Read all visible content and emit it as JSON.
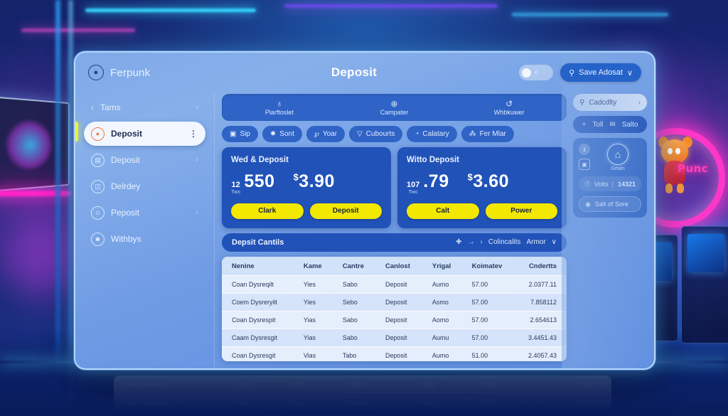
{
  "app": {
    "brand": "Ferpunk",
    "brand_icon": "user-circle-icon",
    "title": "Deposit"
  },
  "topbar": {
    "toggle_icon": "toggle-knob-icon",
    "toggle_chevron": "‹",
    "save_button": {
      "icon": "search-icon",
      "label": "Save Adosat",
      "chevron": "∨"
    }
  },
  "sidebar": {
    "back_chevron": "‹",
    "items": [
      {
        "label": "Tams",
        "icon": "chevron-left-icon",
        "trailing": "›",
        "active": false,
        "kind": "back"
      },
      {
        "label": "Deposit",
        "icon": "coin-icon",
        "trailing": "⋮",
        "active": true,
        "kind": "item"
      },
      {
        "label": "Deposit",
        "icon": "wallet-icon",
        "trailing": "›",
        "active": false,
        "kind": "item"
      },
      {
        "label": "Delrdey",
        "icon": "card-icon",
        "trailing": "",
        "active": false,
        "kind": "item"
      },
      {
        "label": "Peposit",
        "icon": "face-icon",
        "trailing": "›",
        "active": false,
        "kind": "item"
      },
      {
        "label": "Withbys",
        "icon": "smiley-icon",
        "trailing": "",
        "active": false,
        "kind": "item"
      }
    ]
  },
  "tabs": [
    {
      "label": "Plarftoslet",
      "icon": "person-icon",
      "glyph": "♁"
    },
    {
      "label": "Campater",
      "icon": "clock-icon",
      "glyph": "⊕"
    },
    {
      "label": "Whbkuwer",
      "icon": "refresh-icon",
      "glyph": "↺"
    }
  ],
  "chips": [
    {
      "label": "Sip",
      "icon": "briefcase-icon",
      "glyph": "▣"
    },
    {
      "label": "Sont",
      "icon": "star-icon",
      "glyph": "✸"
    },
    {
      "label": "Yoar",
      "icon": "link-icon",
      "glyph": "℘"
    },
    {
      "label": "Cubourts",
      "icon": "filter-icon",
      "glyph": "▽"
    },
    {
      "label": "Calatary",
      "icon": "clock-icon",
      "glyph": "◔"
    },
    {
      "label": "Fer Mlar",
      "icon": "share-icon",
      "glyph": "⁂"
    }
  ],
  "stat_cards": [
    {
      "title": "Wed & Deposit",
      "badge_top": "12",
      "badge_bottom": "Twc",
      "primary_value": "550",
      "currency_symbol": "$",
      "secondary_value": "3.90",
      "buttons": [
        "Clark",
        "Deposit"
      ]
    },
    {
      "title": "Witto Deposit",
      "badge_top": "107",
      "badge_bottom": "Twc",
      "primary_value": ".79",
      "currency_symbol": "$",
      "secondary_value": "3.60",
      "buttons": [
        "Calt",
        "Power"
      ]
    }
  ],
  "right_panel": {
    "search": {
      "icon": "search-icon",
      "label": "Cadcdlty",
      "chevron": "›"
    },
    "actions": {
      "add_icon": "plus-icon",
      "add_label": "Toll",
      "mail_icon": "mail-icon",
      "mail_label": "Salto"
    },
    "side_icons": [
      "info-icon",
      "copy-icon"
    ],
    "home": {
      "icon": "home-icon",
      "label": "Grtatn"
    },
    "stat": {
      "icon": "volt-icon",
      "label": "Volts",
      "separator": "|",
      "value": "14321"
    },
    "button": {
      "icon": "target-icon",
      "label": "Salt of Sore"
    }
  },
  "table": {
    "title": "Depsit Cantils",
    "head_actions": {
      "pin_icon": "✚",
      "arrow_icon": "→",
      "chevron_icon": "›",
      "label": "Colincalits",
      "menu_label": "Armor",
      "menu_chevron": "∨"
    },
    "columns": [
      "Nenine",
      "Kame",
      "Cantre",
      "Canlost",
      "Yrigal",
      "Koimatev",
      "Cndertts"
    ],
    "rows": [
      [
        "Coan Dysreqilt",
        "Yies",
        "Sabo",
        "Deposit",
        "Aumo",
        "57.00",
        "2.0377.11"
      ],
      [
        "Coem Dysreryilt",
        "Yies",
        "Sebo",
        "Deposit",
        "Asmo",
        "57.00",
        "7.858112"
      ],
      [
        "Coan Dysrespit",
        "Yias",
        "Sabo",
        "Deposit",
        "Aomo",
        "57.00",
        "2.654613"
      ],
      [
        "Caam Dysresgit",
        "Yias",
        "Sabo",
        "Deposit",
        "Aumu",
        "57.00",
        "3.4451.43"
      ],
      [
        "Coan Dysresgit",
        "Vias",
        "Tabo",
        "Deposit",
        "Aumo",
        "51.00",
        "2.4057.43"
      ]
    ],
    "overflow_rows": [
      [
        "Coan Dytewols",
        "Fies",
        "Cobb",
        "Dtpeck",
        "Vtroo",
        "8100",
        "3.5527.12"
      ],
      [
        "Coan Cytwoom",
        "Hex",
        "Dbra",
        "Ebwesk",
        "Stooe",
        "C.80",
        "3.1363.13"
      ]
    ]
  },
  "external_pager": {
    "prev": "‹",
    "next": "›",
    "grid_icon": "grid-icon",
    "grid_glyph": "▦"
  },
  "scene": {
    "mascot_word": "Punc",
    "mascot_word2": "✶",
    "neon_colors": {
      "pink": "#ff37c9",
      "cyan": "#35d7ff",
      "purple": "#7b4bff",
      "yellow": "#e8f33a"
    }
  }
}
